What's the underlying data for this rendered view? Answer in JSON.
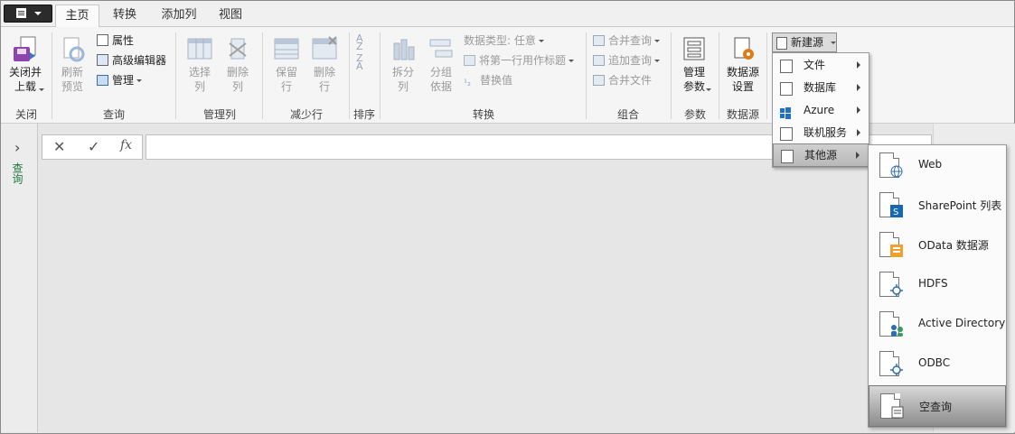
{
  "tabs": [
    "主页",
    "转换",
    "添加列",
    "视图"
  ],
  "active_tab": "主页",
  "ribbon": {
    "close": {
      "button": "关闭并\n上载",
      "group": "关闭"
    },
    "query": {
      "refresh": "刷新\n预览",
      "properties": "属性",
      "advanced_editor": "高级编辑器",
      "manage": "管理",
      "group": "查询"
    },
    "manage_columns": {
      "select": "选择\n列",
      "remove": "删除\n列",
      "group": "管理列"
    },
    "reduce_rows": {
      "keep": "保留\n行",
      "remove": "删除\n行",
      "group": "减少行"
    },
    "sort": {
      "group": "排序"
    },
    "transform": {
      "split": "拆分\n列",
      "group_by": "分组\n依据",
      "data_type": "数据类型: 任意",
      "first_row_header": "将第一行用作标题",
      "replace_values": "替换值",
      "group": "转换"
    },
    "combine": {
      "merge": "合并查询",
      "append": "追加查询",
      "combine_files": "合并文件",
      "group": "组合"
    },
    "parameters": {
      "manage": "管理\n参数",
      "group": "参数"
    },
    "data_source": {
      "settings": "数据源\n设置",
      "group": "数据源"
    },
    "new_source": "新建源"
  },
  "formula_bar": {
    "cancel": "✕",
    "commit": "✓",
    "fx": "fx",
    "value": ""
  },
  "left_pane": {
    "label": "查询"
  },
  "menu_level1": [
    {
      "label": "文件",
      "icon": "file-icon"
    },
    {
      "label": "数据库",
      "icon": "database-icon"
    },
    {
      "label": "Azure",
      "icon": "windows-icon"
    },
    {
      "label": "联机服务",
      "icon": "cloud-icon"
    },
    {
      "label": "其他源",
      "icon": "other-source-icon"
    }
  ],
  "menu_level1_selected": "其他源",
  "menu_level2": [
    {
      "label": "Web",
      "icon": "globe-icon"
    },
    {
      "label": "SharePoint 列表",
      "icon": "sharepoint-icon"
    },
    {
      "label": "OData 数据源",
      "icon": "odata-icon"
    },
    {
      "label": "HDFS",
      "icon": "hdfs-icon"
    },
    {
      "label": "Active Directory",
      "icon": "active-directory-icon"
    },
    {
      "label": "ODBC",
      "icon": "odbc-icon"
    },
    {
      "label": "空查询",
      "icon": "blank-query-icon"
    }
  ],
  "menu_level2_selected": "空查询"
}
